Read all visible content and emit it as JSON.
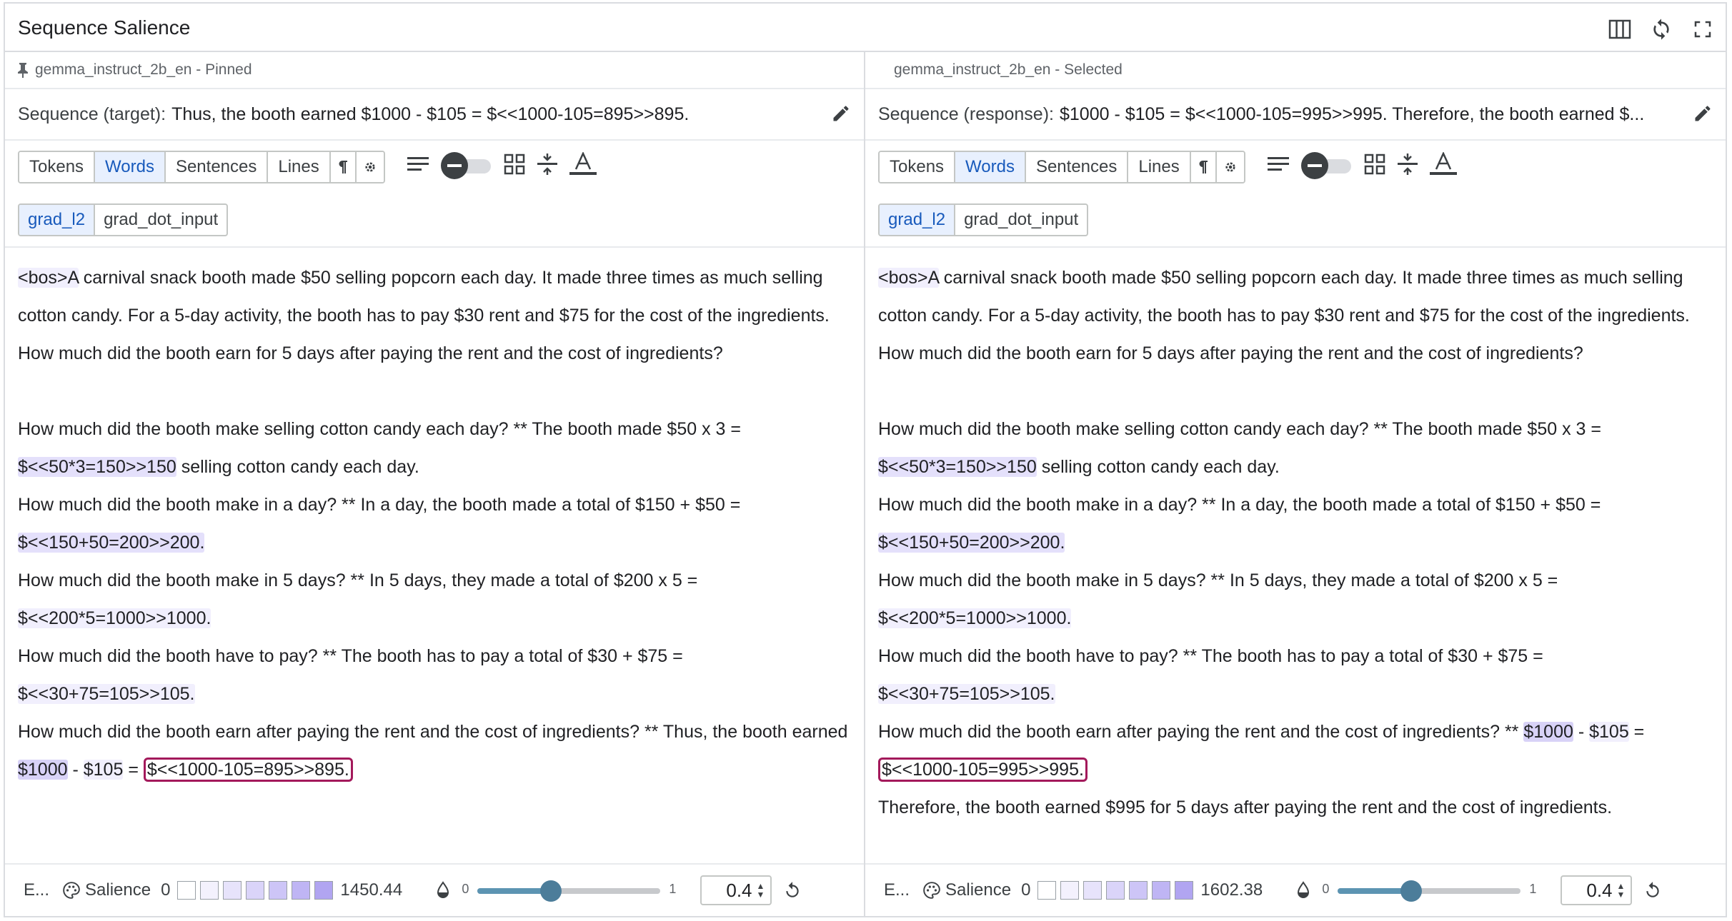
{
  "module": {
    "title": "Sequence Salience"
  },
  "header_icons": [
    "view-columns-icon",
    "refresh-icon",
    "fullscreen-icon"
  ],
  "colors": {
    "highlight": "#e4e0fb",
    "target_outline": "#a3195b",
    "selected_seg": "#e8f0fe",
    "slider_fill": "#5c94b2"
  },
  "left": {
    "model_label": "gemma_instruct_2b_en - Pinned",
    "seq_label": "Sequence (target):",
    "seq_text": "Thus, the booth earned $1000 - $105 = $<<1000-105=895>>895.",
    "granularity": [
      "Tokens",
      "Words",
      "Sentences",
      "Lines"
    ],
    "methods": [
      "grad_l2",
      "grad_dot_input"
    ],
    "text": {
      "p1": "<bos>A carnival snack booth made $50 selling popcorn each day. It made three times as much selling cotton candy. For a 5-day activity, the booth has to pay $30 rent and $75 for the cost of the ingredients. How much did the booth earn for 5 days after paying the rent and the cost of ingredients?",
      "q1": "How much did the booth make selling cotton candy each day? ** The booth made $50 x 3 =",
      "a1": "$<<50*3=150>>150",
      "a1_tail": " selling cotton candy each day.",
      "q2": "How much did the booth make in a day? ** In a day, the booth made a total of $150 + $50 =",
      "a2": "$<<150+50=200>>200.",
      "q3": "How much did the booth make in 5 days? ** In 5 days, they made a total of $200 x 5 =",
      "a3": "$<<200*5=1000>>1000.",
      "q4": "How much did the booth have to pay? ** The booth has to pay a total of $30 + $75 =",
      "a4": "$<<30+75=105>>105.",
      "q5": "How much did the booth earn after paying the rent and the cost of ingredients? ** Thus, the booth earned ",
      "w1": "$1000",
      "w2": " - ",
      "w3": "$105",
      "w4": " = ",
      "target": "$<<1000-105=895>>895."
    },
    "footer": {
      "short": "E...",
      "salience_label": "Salience",
      "min": "0",
      "max": "1450.44",
      "slider_lo": "0",
      "slider_hi": "1",
      "slider_value": 0.4,
      "number": "0.4"
    }
  },
  "right": {
    "model_label": "gemma_instruct_2b_en - Selected",
    "seq_label": "Sequence (response):",
    "seq_text": "$1000 - $105 = $<<1000-105=995>>995. Therefore, the booth earned $...",
    "granularity": [
      "Tokens",
      "Words",
      "Sentences",
      "Lines"
    ],
    "methods": [
      "grad_l2",
      "grad_dot_input"
    ],
    "text": {
      "p1": "<bos>A carnival snack booth made $50 selling popcorn each day. It made three times as much selling cotton candy. For a 5-day activity, the booth has to pay $30 rent and $75 for the cost of the ingredients. How much did the booth earn for 5 days after paying the rent and the cost of ingredients?",
      "q1": "How much did the booth make selling cotton candy each day? ** The booth made $50 x 3 =",
      "a1": "$<<50*3=150>>150",
      "a1_tail": " selling cotton candy each day.",
      "q2": "How much did the booth make in a day? ** In a day, the booth made a total of $150 + $50 =",
      "a2": "$<<150+50=200>>200.",
      "q3": "How much did the booth make in 5 days? ** In 5 days, they made a total of $200 x 5 =",
      "a3": "$<<200*5=1000>>1000.",
      "q4": "How much did the booth have to pay? ** The booth has to pay a total of $30 + $75 =",
      "a4": "$<<30+75=105>>105.",
      "q5": "How much did the booth earn after paying the rent and the cost of ingredients? ** ",
      "w1": "$1000",
      "w2": " - ",
      "w3": "$105",
      "w4": " =",
      "target": "$<<1000-105=995>>995.",
      "tail": "Therefore, the booth earned $995 for 5 days after paying the rent and the cost of ingredients."
    },
    "footer": {
      "short": "E...",
      "salience_label": "Salience",
      "min": "0",
      "max": "1602.38",
      "slider_lo": "0",
      "slider_hi": "1",
      "slider_value": 0.4,
      "number": "0.4"
    }
  }
}
